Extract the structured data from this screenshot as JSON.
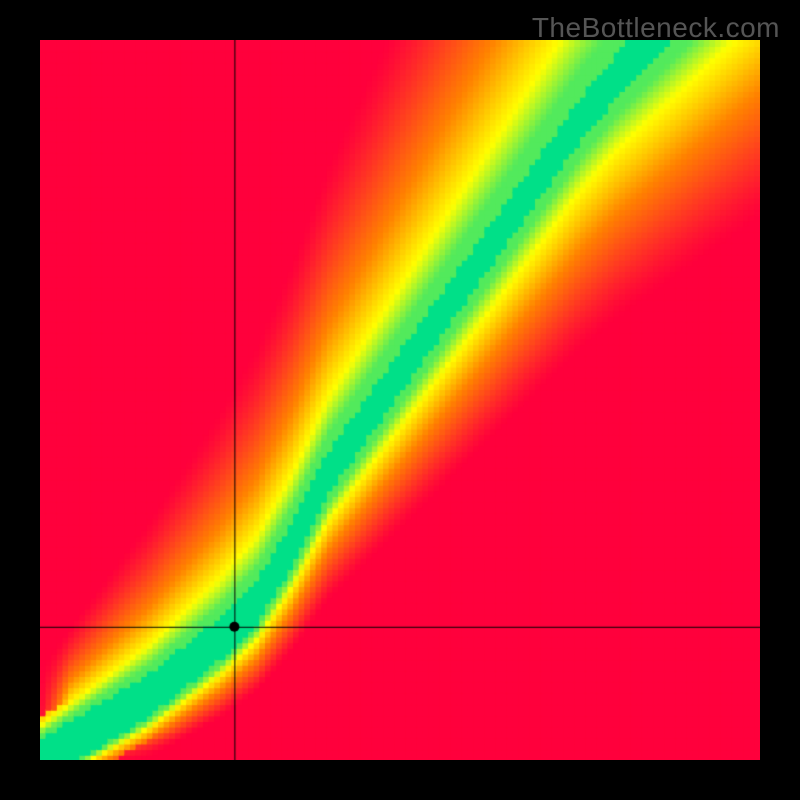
{
  "watermark": "TheBottleneck.com",
  "colors": {
    "background": "#000000",
    "crosshair": "#000000",
    "marker": "#000000"
  },
  "chart_data": {
    "type": "heatmap",
    "title": "",
    "xlabel": "",
    "ylabel": "",
    "xlim": [
      0,
      1
    ],
    "ylim": [
      0,
      1
    ],
    "color_scale": [
      "#ff0033",
      "#ff7f00",
      "#ffff00",
      "#00e088"
    ],
    "color_meaning": "value 1.0 = balanced (green), 0.0 = severe bottleneck (red)",
    "ideal_curve_points": [
      {
        "x": 0.0,
        "y": 0.0
      },
      {
        "x": 0.05,
        "y": 0.03
      },
      {
        "x": 0.1,
        "y": 0.06
      },
      {
        "x": 0.15,
        "y": 0.09
      },
      {
        "x": 0.2,
        "y": 0.13
      },
      {
        "x": 0.25,
        "y": 0.17
      },
      {
        "x": 0.3,
        "y": 0.22
      },
      {
        "x": 0.35,
        "y": 0.3
      },
      {
        "x": 0.4,
        "y": 0.4
      },
      {
        "x": 0.45,
        "y": 0.47
      },
      {
        "x": 0.5,
        "y": 0.54
      },
      {
        "x": 0.55,
        "y": 0.61
      },
      {
        "x": 0.6,
        "y": 0.68
      },
      {
        "x": 0.65,
        "y": 0.75
      },
      {
        "x": 0.7,
        "y": 0.82
      },
      {
        "x": 0.75,
        "y": 0.89
      },
      {
        "x": 0.8,
        "y": 0.95
      },
      {
        "x": 0.85,
        "y": 1.0
      }
    ],
    "ideal_band_width": 0.06,
    "marker": {
      "x": 0.27,
      "y": 0.185,
      "radius_px": 5
    },
    "crosshair": {
      "x": 0.27,
      "y": 0.185
    },
    "pixelation": 128
  }
}
